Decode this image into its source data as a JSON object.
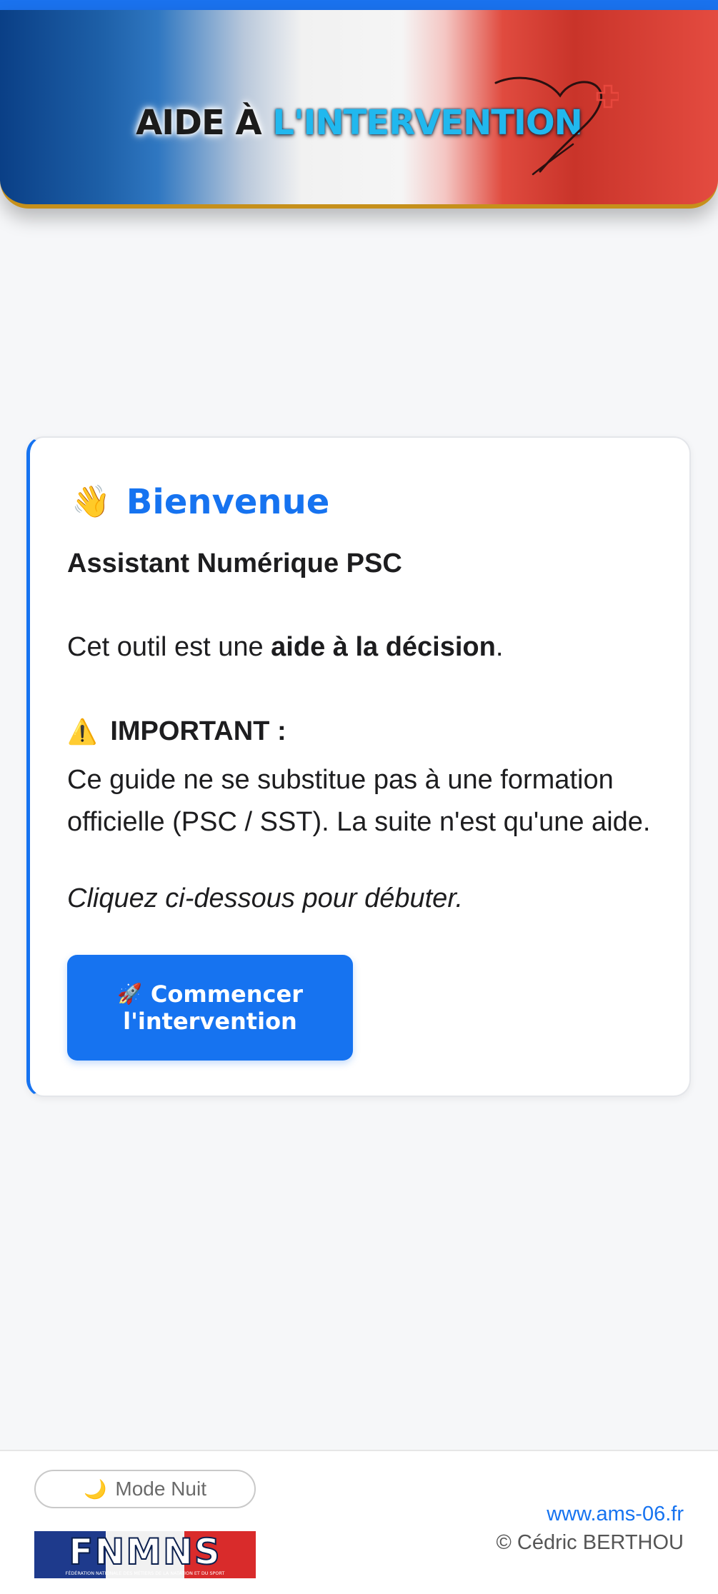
{
  "header": {
    "title_part1": "AIDE À ",
    "title_part2": "L'INTERVENTION"
  },
  "welcome": {
    "icon": "waving-hand-icon",
    "title": "Bienvenue",
    "subtitle": "Assistant Numérique PSC",
    "intro_prefix": "Cet outil est une ",
    "intro_bold": "aide à la décision",
    "intro_suffix": ".",
    "important_icon": "warning-icon",
    "important_label": "IMPORTANT :",
    "important_text": "Ce guide ne se substitue pas à une formation officielle (PSC / SST). La suite n'est qu'une aide.",
    "cta_hint": "Cliquez ci-dessous pour débuter.",
    "start_button": {
      "icon": "rocket-icon",
      "line1": "Commencer",
      "line2": "l'intervention"
    }
  },
  "footer": {
    "night_mode_icon": "moon-icon",
    "night_mode_label": "Mode Nuit",
    "logo_text": "FNMNS",
    "logo_subtext": "FÉDÉRATION NATIONALE DES MÉTIERS DE LA NATATION ET DU SPORT",
    "website": "www.ams-06.fr",
    "copyright": "© Cédric BERTHOU"
  },
  "colors": {
    "accent": "#1673f0",
    "banner_blue": "#0a3f86",
    "banner_red": "#e04b3f",
    "banner_border": "#c6901b",
    "title_cyan": "#21b8ee"
  }
}
